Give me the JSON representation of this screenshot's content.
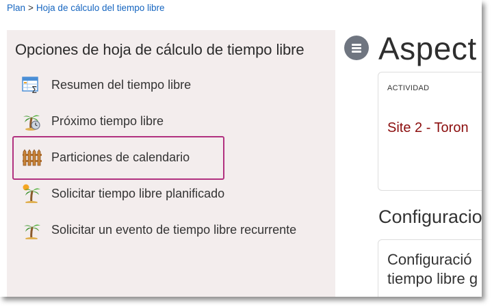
{
  "breadcrumb": {
    "root": "Plan",
    "separator": ">",
    "current": "Hoja de cálculo del tiempo libre"
  },
  "panel": {
    "title": "Opciones de hoja de cálculo de tiempo libre",
    "items": [
      {
        "label": "Resumen del tiempo libre",
        "icon": "sigma-spreadsheet-icon"
      },
      {
        "label": "Próximo tiempo libre",
        "icon": "palm-tree-clock-icon"
      },
      {
        "label": "Particiones de calendario",
        "icon": "fence-icon",
        "highlighted": true
      },
      {
        "label": "Solicitar tiempo libre planificado",
        "icon": "palm-tree-sun-icon"
      },
      {
        "label": "Solicitar un evento de tiempo libre recurrente",
        "icon": "palm-tree-icon"
      }
    ]
  },
  "main": {
    "title": "Aspect",
    "activity_label": "ACTIVIDAD",
    "activity_value": "Site 2 - Toron",
    "config_heading": "Configuracio",
    "config_text_line1": "Configuració",
    "config_text_line2": "tiempo libre g"
  },
  "colors": {
    "link": "#1565c0",
    "highlight": "#b1307f",
    "activity_value": "#8b0d0d",
    "panel_bg": "#f3eded"
  }
}
